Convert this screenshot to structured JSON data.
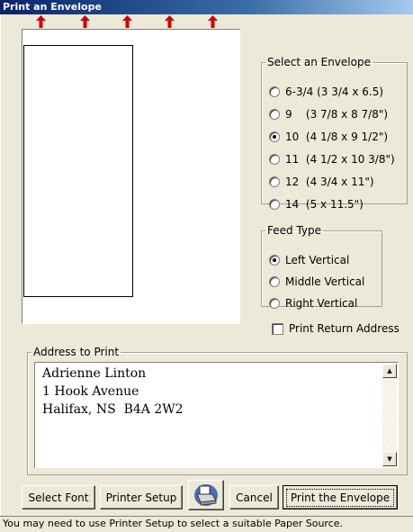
{
  "window": {
    "title": "Print an Envelope"
  },
  "envelope_group": {
    "legend": "Select an Envelope",
    "options": [
      {
        "label": "6-3/4 (3 3/4 x 6.5)",
        "selected": false
      },
      {
        "label": "9    (3 7/8 x 8 7/8\")",
        "selected": false
      },
      {
        "label": "10  (4 1/8 x 9 1/2\")",
        "selected": true
      },
      {
        "label": "11  (4 1/2 x 10 3/8\")",
        "selected": false
      },
      {
        "label": "12  (4 3/4 x 11\")",
        "selected": false
      },
      {
        "label": "14  (5 x 11.5\")",
        "selected": false
      }
    ]
  },
  "feed_group": {
    "legend": "Feed Type",
    "options": [
      {
        "label": "Left Vertical",
        "selected": true
      },
      {
        "label": "Middle Vertical",
        "selected": false
      },
      {
        "label": "Right Vertical",
        "selected": false
      }
    ]
  },
  "return_address": {
    "label": "Print Return Address",
    "checked": false
  },
  "address": {
    "legend": "Address to Print",
    "lines": [
      "Adrienne Linton",
      "1 Hook Avenue",
      "Halifax, NS  B4A 2W2"
    ]
  },
  "buttons": {
    "select_font": "Select Font",
    "printer_setup": "Printer Setup",
    "cancel": "Cancel",
    "print": "Print the Envelope"
  },
  "status": "You may need to use Printer Setup to select a suitable Paper Source.",
  "colors": {
    "arrow": "#CC0000",
    "title_bar": "#0A246A"
  },
  "icons": {
    "feed_arrow": "up-arrow-icon",
    "printer": "printer-icon"
  }
}
